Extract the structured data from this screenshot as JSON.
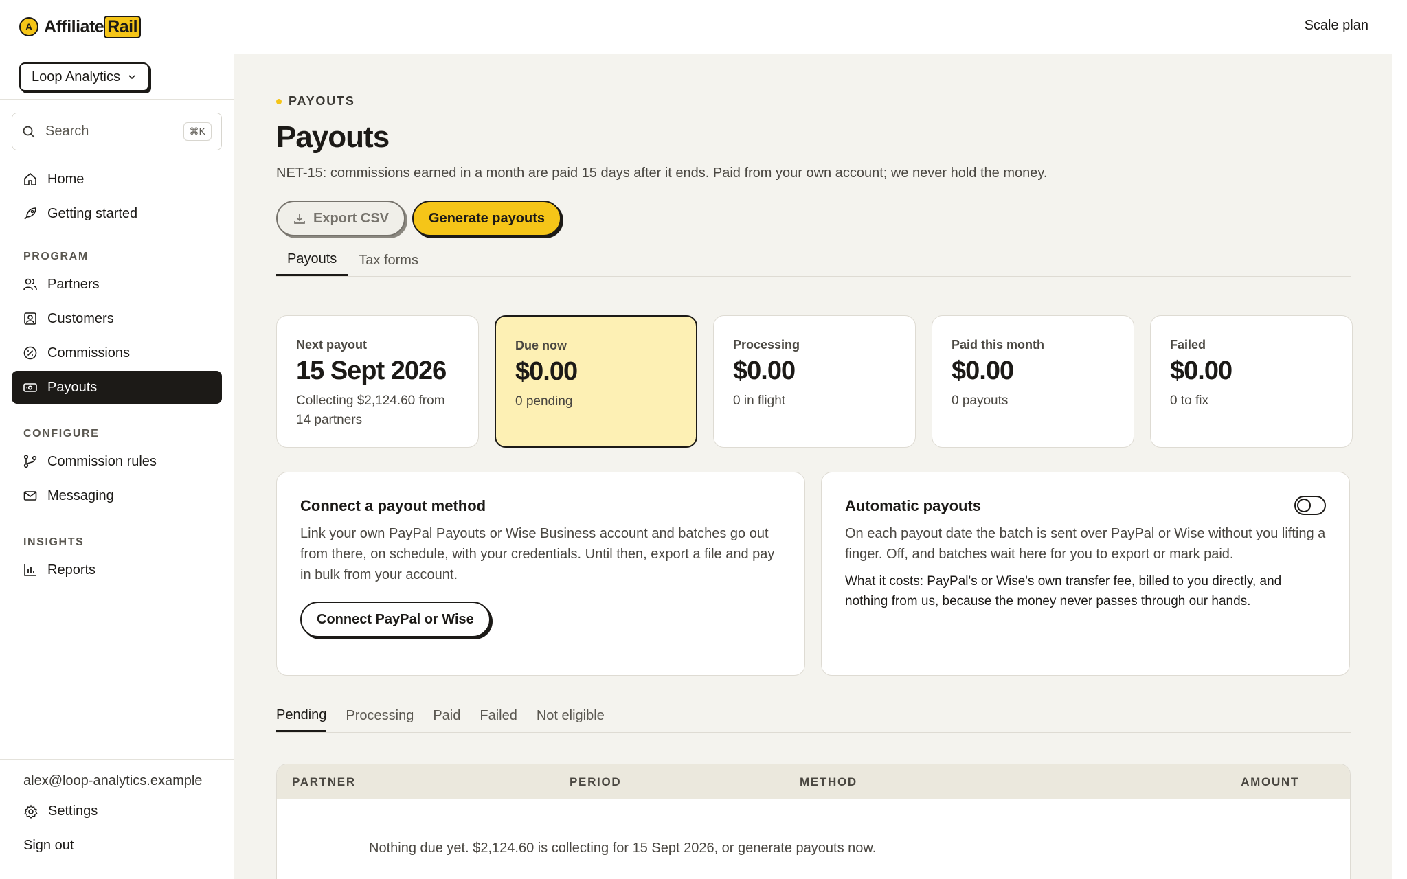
{
  "brand": {
    "name": "Affiliate",
    "name_highlight": "Rail",
    "logo_letter": "A"
  },
  "workspace": {
    "name": "Loop Analytics"
  },
  "search": {
    "placeholder": "Search",
    "shortcut": "⌘K"
  },
  "nav": {
    "top": [
      {
        "label": "Home",
        "icon": "home-icon"
      },
      {
        "label": "Getting started",
        "icon": "rocket-icon"
      }
    ],
    "sections": [
      {
        "title": "PROGRAM",
        "items": [
          {
            "label": "Partners",
            "icon": "users-icon"
          },
          {
            "label": "Customers",
            "icon": "contact-icon"
          },
          {
            "label": "Commissions",
            "icon": "percent-icon"
          },
          {
            "label": "Payouts",
            "icon": "banknote-icon",
            "active": true
          }
        ]
      },
      {
        "title": "CONFIGURE",
        "items": [
          {
            "label": "Commission rules",
            "icon": "branch-icon"
          },
          {
            "label": "Messaging",
            "icon": "mail-icon"
          }
        ]
      },
      {
        "title": "INSIGHTS",
        "items": [
          {
            "label": "Reports",
            "icon": "bar-chart-icon"
          }
        ]
      }
    ]
  },
  "footer": {
    "email": "alex@loop-analytics.example",
    "settings_label": "Settings",
    "signout_label": "Sign out"
  },
  "topbar": {
    "plan_label": "Scale plan"
  },
  "page": {
    "eyebrow": "PAYOUTS",
    "title": "Payouts",
    "description": "NET-15: commissions earned in a month are paid 15 days after it ends. Paid from your own account; we never hold the money.",
    "export_label": "Export CSV",
    "generate_label": "Generate payouts"
  },
  "tabs": [
    {
      "label": "Payouts",
      "active": true
    },
    {
      "label": "Tax forms"
    }
  ],
  "stats": [
    {
      "label": "Next payout",
      "value": "15 Sept 2026",
      "sub": "Collecting $2,124.60 from 14 partners"
    },
    {
      "label": "Due now",
      "value": "$0.00",
      "sub": "0 pending",
      "highlight": true
    },
    {
      "label": "Processing",
      "value": "$0.00",
      "sub": "0 in flight"
    },
    {
      "label": "Paid this month",
      "value": "$0.00",
      "sub": "0 payouts"
    },
    {
      "label": "Failed",
      "value": "$0.00",
      "sub": "0 to fix"
    }
  ],
  "connect": {
    "title": "Connect a payout method",
    "body": "Link your own PayPal Payouts or Wise Business account and batches go out from there, on schedule, with your credentials. Until then, export a file and pay in bulk from your account.",
    "button": "Connect PayPal or Wise"
  },
  "auto": {
    "title": "Automatic payouts",
    "body": "On each payout date the batch is sent over PayPal or Wise without you lifting a finger. Off, and batches wait here for you to export or mark paid.",
    "cost": "What it costs: PayPal's or Wise's own transfer fee, billed to you directly, and nothing from us, because the money never passes through our hands.",
    "enabled": false
  },
  "status_tabs": [
    {
      "label": "Pending",
      "active": true
    },
    {
      "label": "Processing"
    },
    {
      "label": "Paid"
    },
    {
      "label": "Failed"
    },
    {
      "label": "Not eligible"
    }
  ],
  "table": {
    "columns": [
      "PARTNER",
      "PERIOD",
      "METHOD",
      "AMOUNT"
    ],
    "empty_message": "Nothing due yet. $2,124.60 is collecting for 15 Sept 2026, or generate payouts now."
  },
  "colors": {
    "accent": "#f5c518",
    "ink": "#1c1a17",
    "highlight_card": "#fdf0b4"
  }
}
